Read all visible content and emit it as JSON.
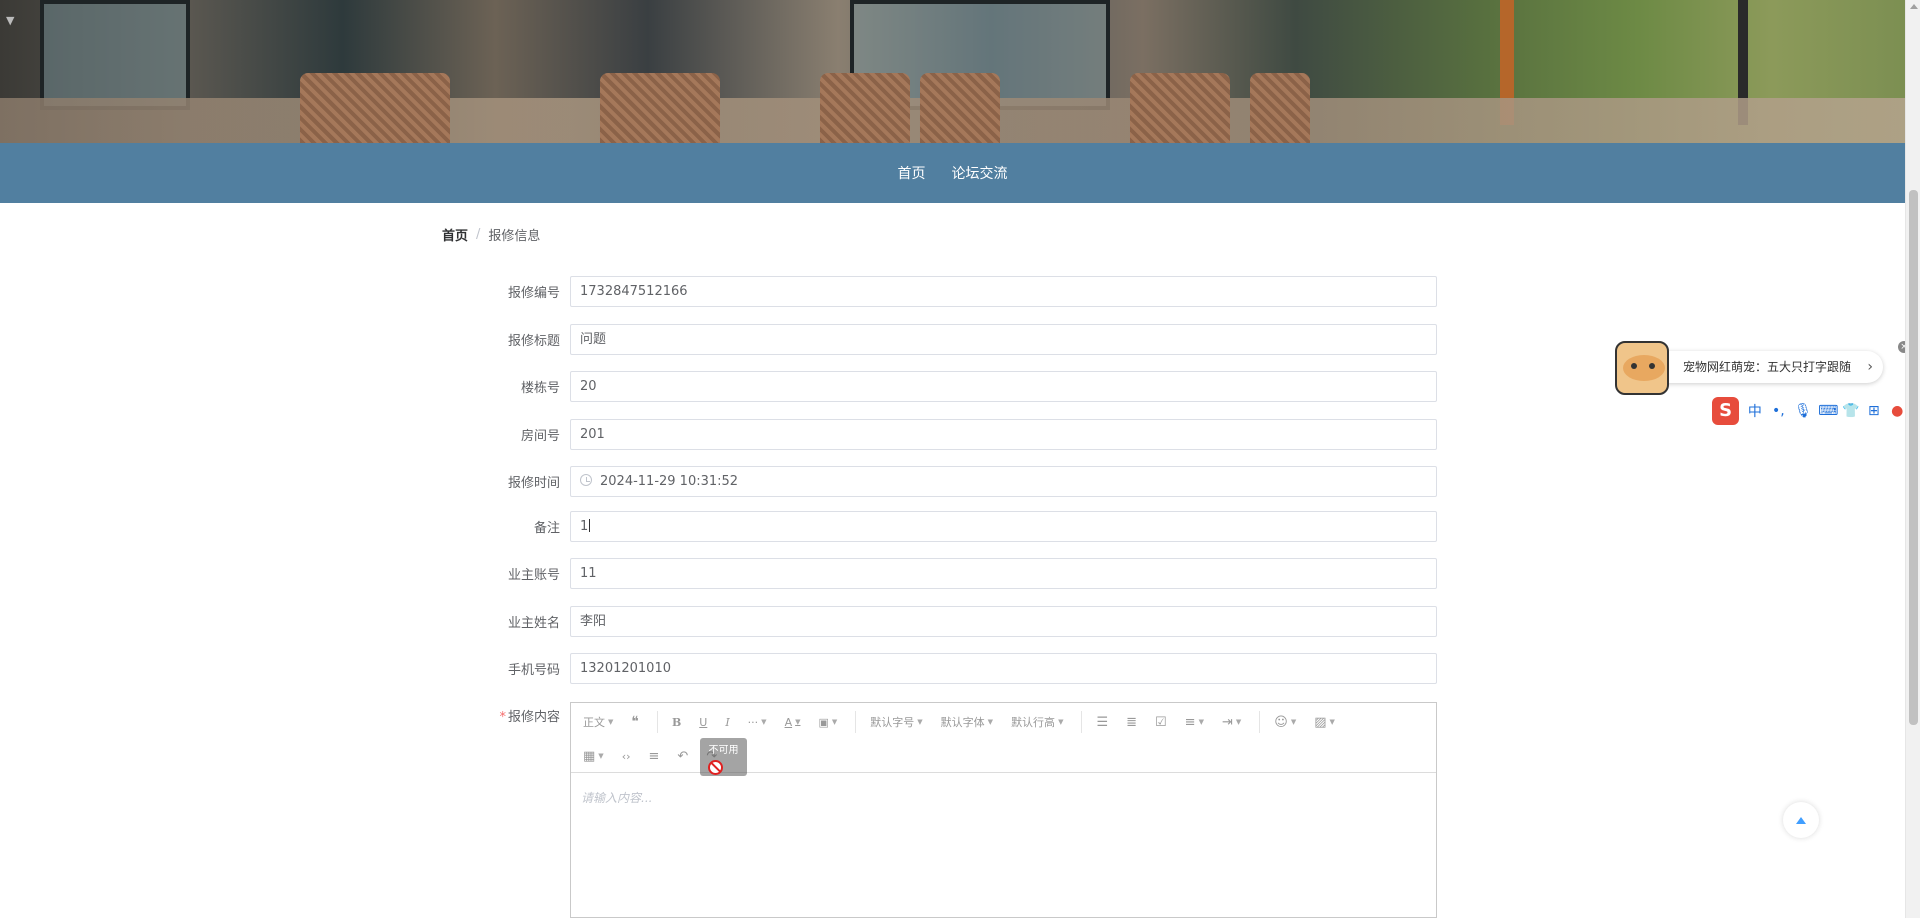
{
  "nav": {
    "items": [
      {
        "label": "首页"
      },
      {
        "label": "论坛交流"
      }
    ]
  },
  "breadcrumb": {
    "home": "首页",
    "separator": "/",
    "current": "报修信息"
  },
  "form": {
    "fields": [
      {
        "label": "报修编号",
        "value": "1732847512166"
      },
      {
        "label": "报修标题",
        "value": "问题"
      },
      {
        "label": "楼栋号",
        "value": "20"
      },
      {
        "label": "房间号",
        "value": "201"
      },
      {
        "label": "报修时间",
        "value": "2024-11-29 10:31:52"
      },
      {
        "label": "备注",
        "value": "1"
      },
      {
        "label": "业主账号",
        "value": "11"
      },
      {
        "label": "业主姓名",
        "value": "李阳"
      },
      {
        "label": "手机号码",
        "value": "13201201010"
      }
    ],
    "content_label": "报修内容",
    "required_mark": "*"
  },
  "editor": {
    "toolbar": {
      "paragraph": "正文",
      "font_size": "默认字号",
      "font_family": "默认字体",
      "line_height": "默认行高"
    },
    "placeholder": "请输入内容...",
    "tooltip": "不可用"
  },
  "ime": {
    "ad_text": "宠物网红萌宠：五大只打字跟随",
    "bar_label": "中"
  },
  "colors": {
    "nav_bg": "#517fa0",
    "required": "#f56c6c",
    "accent": "#409eff"
  }
}
